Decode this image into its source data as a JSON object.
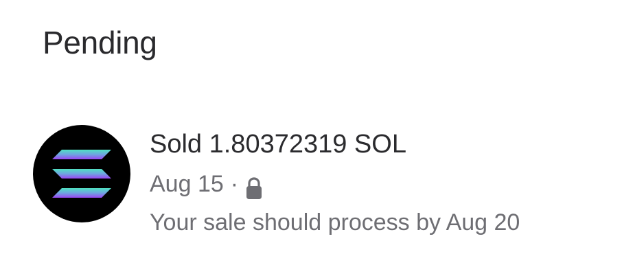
{
  "section": {
    "title": "Pending"
  },
  "transactions": [
    {
      "icon": "solana-logo-icon",
      "title": "Sold 1.80372319 SOL",
      "date": "Aug 15",
      "separator": "·",
      "privacy_icon": "lock-icon",
      "note": "Your sale should process by Aug 20"
    }
  ],
  "colors": {
    "text_primary": "#2b2b2e",
    "text_secondary": "#6e6e73",
    "icon_bg": "#000000",
    "solana_gradient_start": "#4fe1c2",
    "solana_gradient_end": "#9b45f5"
  }
}
